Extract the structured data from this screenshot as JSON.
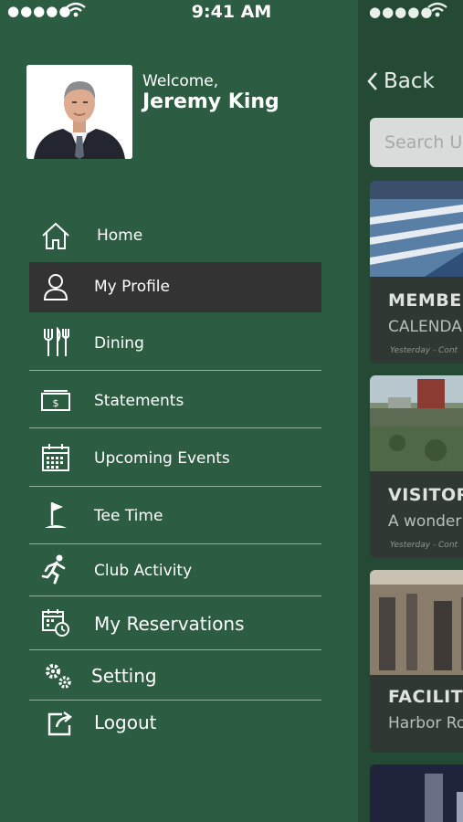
{
  "status_bar": {
    "signal": "●●●●●",
    "time": "9:41 AM",
    "behind_signal": "●●●●●"
  },
  "user": {
    "welcome": "Welcome,",
    "name": "Jeremy King"
  },
  "menu": {
    "items": [
      {
        "label": "Home",
        "icon": "home-icon"
      },
      {
        "label": "My Profile",
        "icon": "user-icon",
        "active": true
      },
      {
        "label": "Dining",
        "icon": "dining-icon"
      },
      {
        "label": "Statements",
        "icon": "statements-icon"
      },
      {
        "label": "Upcoming Events",
        "icon": "calendar-icon"
      },
      {
        "label": "Tee Time",
        "icon": "golf-flag-icon"
      },
      {
        "label": "Club Activity",
        "icon": "runner-icon"
      },
      {
        "label": "My Reservations",
        "icon": "reservations-icon"
      },
      {
        "label": "Setting",
        "icon": "gears-icon"
      },
      {
        "label": "Logout",
        "icon": "logout-icon"
      }
    ]
  },
  "behind": {
    "back_label": "Back",
    "search_placeholder": "Search U",
    "cards": [
      {
        "title": "MEMBE",
        "subtitle": "CALENDA",
        "meta": "Yesterday - Cont"
      },
      {
        "title": "VISITOR",
        "subtitle": "A wonder",
        "meta": "Yesterday - Cont"
      },
      {
        "title": "FACILIT",
        "subtitle": "Harbor Ro",
        "meta": ""
      }
    ]
  },
  "colors": {
    "drawer_bg": "#2c5c41",
    "active_item_bg": "#333333",
    "divider": "#8fb09c"
  }
}
